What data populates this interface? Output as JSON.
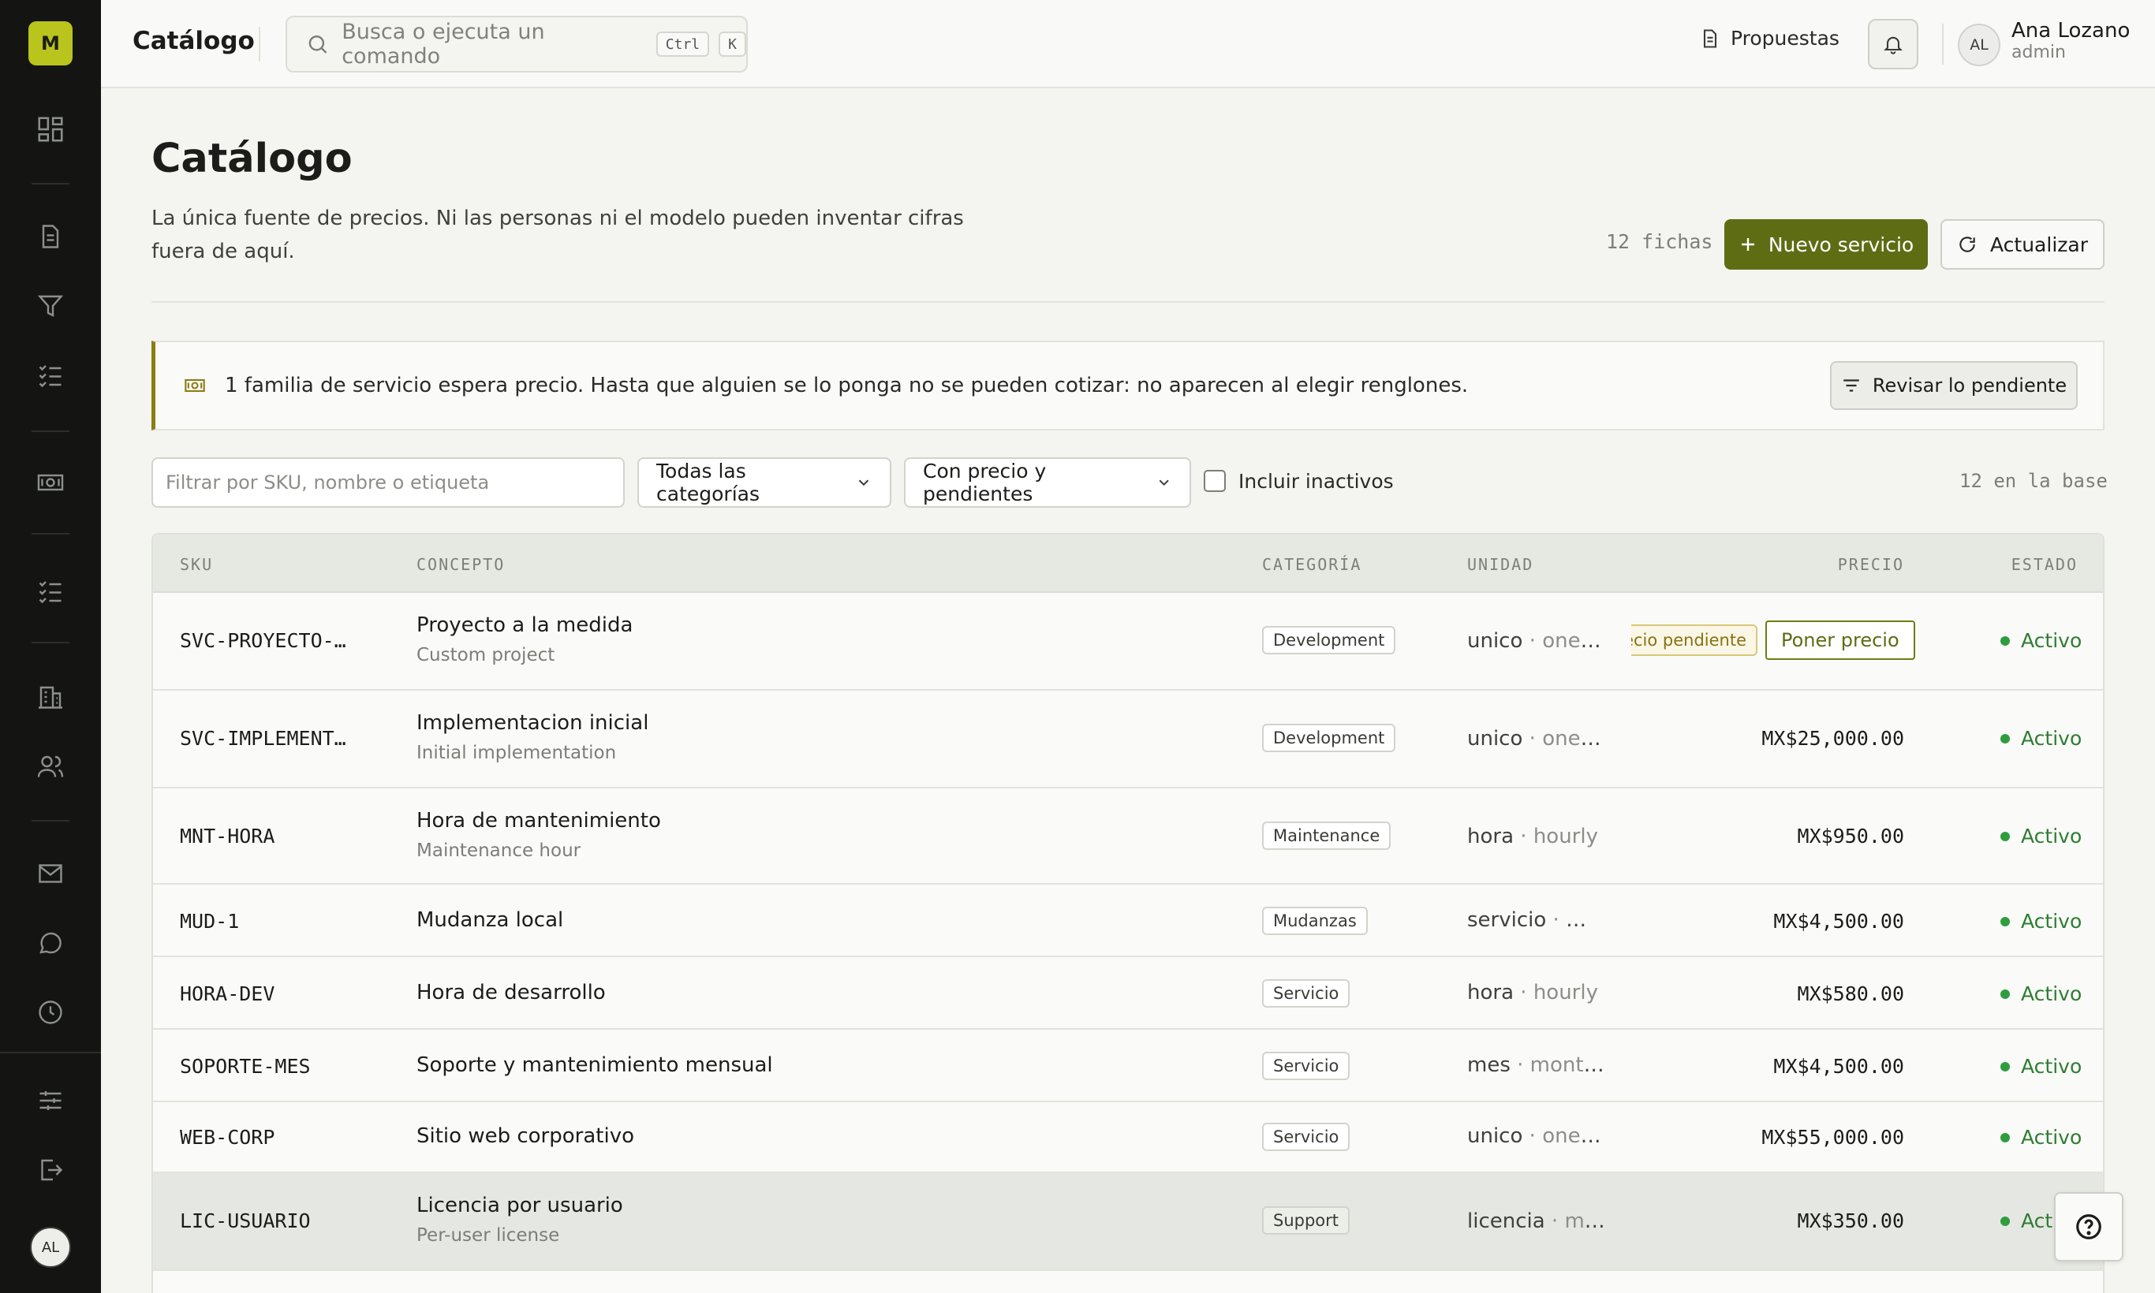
{
  "app": {
    "logo_letter": "M"
  },
  "topbar": {
    "title": "Catálogo",
    "search_placeholder": "Busca o ejecuta un comando",
    "kbd_ctrl": "Ctrl",
    "kbd_k": "K",
    "proposals_label": "Propuestas",
    "user": {
      "initials": "AL",
      "name": "Ana Lozano",
      "role": "admin"
    }
  },
  "sidebar": {
    "icons": [
      "dashboard-icon",
      "document-icon",
      "funnel-icon",
      "checklist-icon",
      "banknote-icon",
      "checklist-icon",
      "building-icon",
      "users-icon",
      "mail-icon",
      "chat-icon",
      "clock-icon",
      "sliders-icon",
      "logout-icon"
    ],
    "avatar_initials": "AL"
  },
  "header": {
    "title": "Catálogo",
    "subtitle": "La única fuente de precios. Ni las personas ni el modelo pueden inventar cifras fuera de aquí.",
    "count": "12 fichas",
    "new_button": "Nuevo servicio",
    "refresh_button": "Actualizar"
  },
  "alert": {
    "text": "1 familia de servicio espera precio. Hasta que alguien se lo ponga no se pueden cotizar: no aparecen al elegir renglones.",
    "button": "Revisar lo pendiente",
    "accent_color": "#8a7d11"
  },
  "filters": {
    "search_placeholder": "Filtrar por SKU, nombre o etiqueta",
    "category_value": "Todas las categorías",
    "price_value": "Con precio y pendientes",
    "include_inactive_label": "Incluir inactivos",
    "include_inactive_checked": false,
    "base_count": "12 en la base"
  },
  "table": {
    "columns": [
      "SKU",
      "CONCEPTO",
      "CATEGORÍA",
      "UNIDAD",
      "PRECIO",
      "ESTADO"
    ],
    "rows": [
      {
        "sku": "SVC-PROYECTO-…",
        "name": "Proyecto a la medida",
        "name_en": "Custom project",
        "category": "Development",
        "unit": "unico",
        "unit_en": "one-…",
        "price": "",
        "pending_label": "ecio pendiente",
        "action_label": "Poner precio",
        "status": "Activo"
      },
      {
        "sku": "SVC-IMPLEMENT…",
        "name": "Implementacion inicial",
        "name_en": "Initial implementation",
        "category": "Development",
        "unit": "unico",
        "unit_en": "one-…",
        "price": "MX$25,000.00",
        "status": "Activo"
      },
      {
        "sku": "MNT-HORA",
        "name": "Hora de mantenimiento",
        "name_en": "Maintenance hour",
        "category": "Maintenance",
        "unit": "hora",
        "unit_en": "hourly",
        "price": "MX$950.00",
        "status": "Activo"
      },
      {
        "sku": "MUD-1",
        "name": "Mudanza local",
        "name_en": "",
        "category": "Mudanzas",
        "unit": "servicio",
        "unit_en": "m…",
        "price": "MX$4,500.00",
        "status": "Activo"
      },
      {
        "sku": "HORA-DEV",
        "name": "Hora de desarrollo",
        "name_en": "",
        "category": "Servicio",
        "unit": "hora",
        "unit_en": "hourly",
        "price": "MX$580.00",
        "status": "Activo"
      },
      {
        "sku": "SOPORTE-MES",
        "name": "Soporte y mantenimiento mensual",
        "name_en": "",
        "category": "Servicio",
        "unit": "mes",
        "unit_en": "monthly",
        "price": "MX$4,500.00",
        "status": "Activo"
      },
      {
        "sku": "WEB-CORP",
        "name": "Sitio web corporativo",
        "name_en": "",
        "category": "Servicio",
        "unit": "unico",
        "unit_en": "one-…",
        "price": "MX$55,000.00",
        "status": "Activo"
      },
      {
        "sku": "LIC-USUARIO",
        "name": "Licencia por usuario",
        "name_en": "Per-user license",
        "category": "Support",
        "unit": "licencia",
        "unit_en": "mo…",
        "price": "MX$350.00",
        "status": "Acti"
      }
    ]
  },
  "colors": {
    "brand": "#b9c41c",
    "primary_button": "#5e6d14",
    "status_active": "#2e7d32",
    "sidebar_bg": "#141513"
  }
}
